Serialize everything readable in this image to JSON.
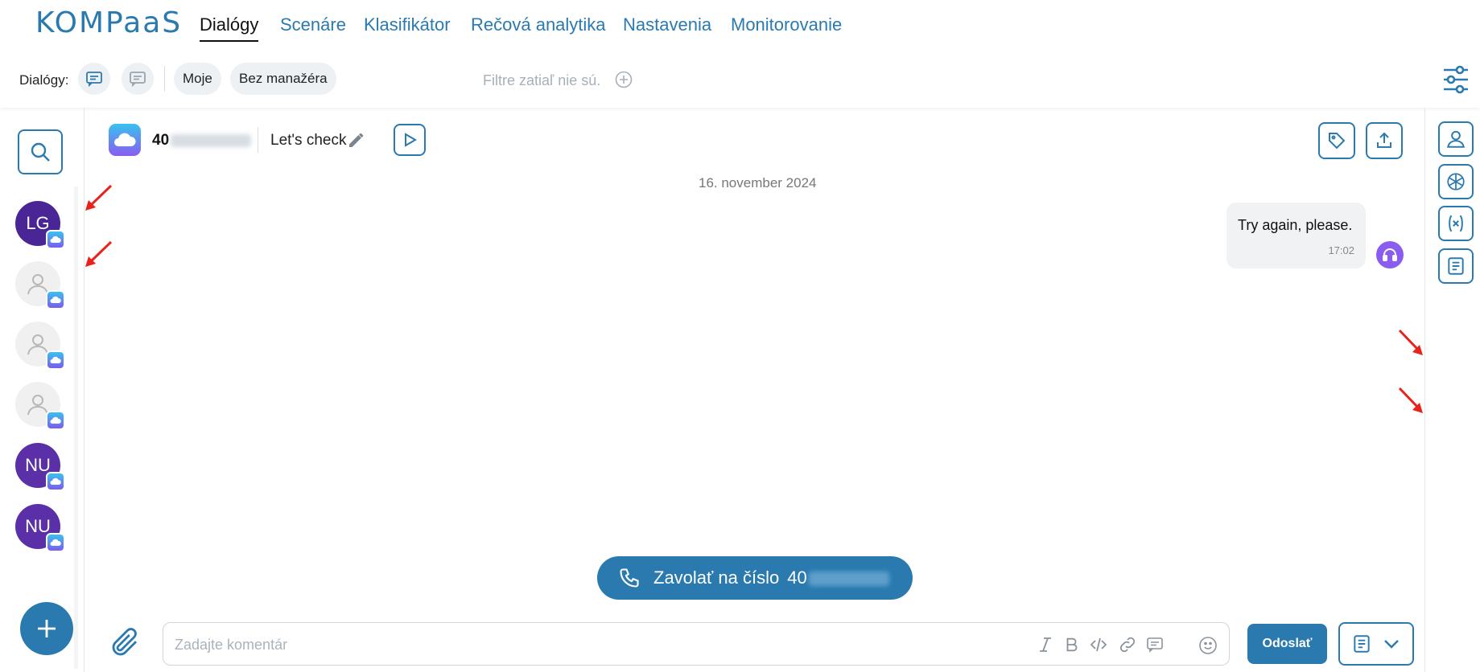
{
  "app": {
    "logo_text": "KOMPaaS",
    "brand_color": "#2a7ab0"
  },
  "nav": {
    "items": [
      {
        "label": "Dialógy",
        "active": true
      },
      {
        "label": "Scenáre"
      },
      {
        "label": "Klasifikátor"
      },
      {
        "label": "Rečová analytika"
      },
      {
        "label": "Nastavenia"
      },
      {
        "label": "Monitorovanie"
      }
    ]
  },
  "toolbar": {
    "label": "Dialógy:",
    "filter_mine": "Moje",
    "filter_no_manager": "Bez manažéra",
    "filters_placeholder": "Filtre zatiaľ nie sú."
  },
  "dialogs": [
    {
      "initials": "LG",
      "type": "initials"
    },
    {
      "initials": "",
      "type": "anonymous"
    },
    {
      "initials": "",
      "type": "anonymous"
    },
    {
      "initials": "",
      "type": "anonymous"
    },
    {
      "initials": "NU",
      "type": "initials"
    },
    {
      "initials": "NU",
      "type": "initials"
    }
  ],
  "chat": {
    "phone_visible": "40",
    "title": "Let's check",
    "date": "16. november 2024",
    "messages": [
      {
        "text": "Try again, please.",
        "time": "17:02",
        "direction": "outgoing"
      }
    ]
  },
  "call_button": {
    "label": "Zavolať na číslo",
    "number_visible": "40"
  },
  "composer": {
    "placeholder": "Zadajte komentár",
    "send_label": "Odoslať"
  }
}
